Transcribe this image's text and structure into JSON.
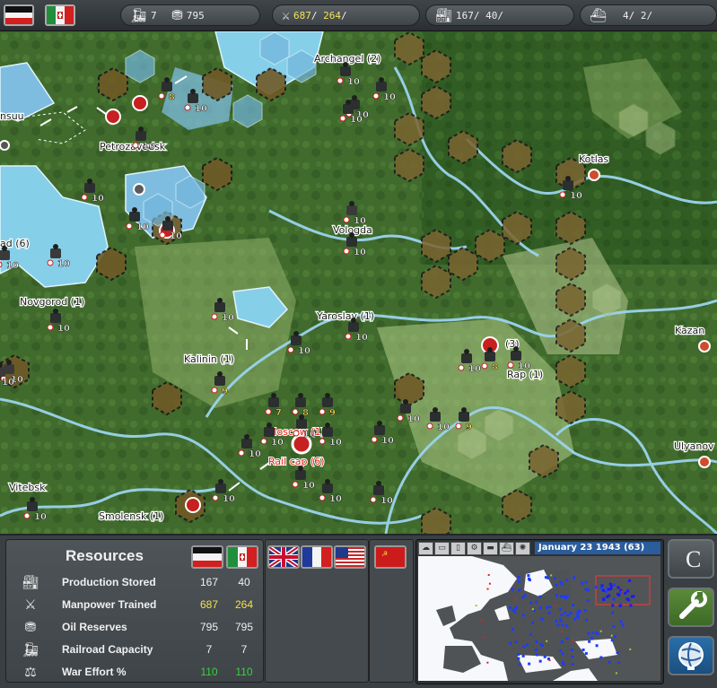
{
  "topbar": {
    "flags": [
      "germany-flag",
      "italy-flag"
    ],
    "rail": {
      "icon": "locomotive-icon",
      "value": "7"
    },
    "oil": {
      "icon": "oil-barrels-icon",
      "value": "795"
    },
    "manpower": {
      "icon": "soldiers-icon",
      "value_a": "687",
      "sep_a": "/",
      "value_b": "264",
      "sep_b": "/"
    },
    "production": {
      "icon": "factory-icon",
      "value_a": "167",
      "sep_a": "/",
      "value_b": "40",
      "sep_b": "/"
    },
    "naval": {
      "icon": "warship-icon",
      "value_a": "4",
      "sep_a": "/",
      "value_b": "2",
      "sep_b": "/"
    }
  },
  "map": {
    "cities": [
      {
        "name": "Archangel (2)"
      },
      {
        "name": "Petrozavodsk"
      },
      {
        "name": "Kotlas"
      },
      {
        "name": "Vologda"
      },
      {
        "name": "Novgorod (1)"
      },
      {
        "name": "Yaroslav (1)"
      },
      {
        "name": "Kalinin (1)"
      },
      {
        "name": "Kazan"
      },
      {
        "name": "Ulyanov"
      },
      {
        "name": "Vitebsk"
      },
      {
        "name": "Smolensk (1)"
      },
      {
        "name": "nsuu"
      },
      {
        "name": "ad (6)"
      },
      {
        "name": "(3)"
      },
      {
        "name": "Rap (1)"
      }
    ],
    "red_labels": [
      "Moscow (1)",
      "Rail cap (6)"
    ],
    "unit_strengths": [
      "8",
      "10",
      "10",
      "10",
      "10",
      "10",
      "10",
      "10",
      "10",
      "10",
      "10",
      "10",
      "10",
      "10",
      "10",
      "10",
      "9",
      "7",
      "8",
      "9",
      "10",
      "10",
      "10",
      "10",
      "10",
      "10",
      "10",
      "10",
      "10",
      "10",
      "10",
      "10",
      "9",
      "10",
      "8",
      "10",
      "10",
      "10",
      "10",
      "10",
      "10"
    ]
  },
  "resources": {
    "title": "Resources",
    "rows": [
      {
        "icon": "factory-icon",
        "label": "Production Stored",
        "v1": "167",
        "v2": "40",
        "color": "white"
      },
      {
        "icon": "soldiers-icon",
        "label": "Manpower Trained",
        "v1": "687",
        "v2": "264",
        "color": "yellow"
      },
      {
        "icon": "oil-barrels-icon",
        "label": "Oil Reserves",
        "v1": "795",
        "v2": "795",
        "color": "white"
      },
      {
        "icon": "locomotive-icon",
        "label": "Railroad Capacity",
        "v1": "7",
        "v2": "7",
        "color": "white"
      },
      {
        "icon": "scales-icon",
        "label": "War Effort %",
        "v1": "110",
        "v2": "110",
        "color": "green"
      }
    ]
  },
  "nations": {
    "axis": [
      "germany-flag",
      "italy-flag"
    ],
    "allies": [
      "uk-flag",
      "france-flag",
      "usa-flag"
    ],
    "soviet": [
      "ussr-flag"
    ]
  },
  "minimap": {
    "date": "January 23 1943 (63)",
    "tools": [
      "cloud-icon",
      "layers-icon",
      "phone-icon",
      "gear-icon",
      "tank-icon",
      "ship-icon",
      "globe-icon",
      "search-icon"
    ]
  },
  "right_buttons": {
    "top_label": "C",
    "tools_icon": "wrench-icon",
    "globe_icon": "globe-icon"
  },
  "colors": {
    "forest": "#3f6a2c",
    "plains": "#8faa66",
    "water": "#7fc9e8",
    "german_zone": "#6b5a2a",
    "soviet_zone": "#b0c58a",
    "accent_blue": "#2b5c9c"
  }
}
